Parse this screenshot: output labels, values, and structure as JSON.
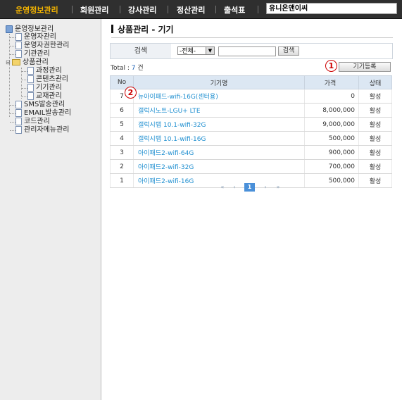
{
  "nav": {
    "items": [
      "운영정보관리",
      "회원관리",
      "강사관리",
      "정산관리",
      "출석표"
    ],
    "active_index": 0,
    "company": "유니온앤이씨"
  },
  "sidebar": {
    "root": "운영정보관리",
    "items": [
      "운영자관리",
      "운영자권한관리",
      "기관관리"
    ],
    "product_folder": "상품관리",
    "product_items": [
      "과정관리",
      "콘텐츠관리",
      "기기관리",
      "교재관리"
    ],
    "bottom_items": [
      "SMS발송관리",
      "EMAIL발송관리",
      "코드관리",
      "관리자메뉴관리"
    ]
  },
  "page": {
    "title": "상품관리 - 기기"
  },
  "search": {
    "label": "검색",
    "select_value": "-전체-",
    "select_arrow": "▼",
    "input_value": "",
    "button": "검색"
  },
  "total": {
    "prefix": "Total : ",
    "count": "7",
    "suffix": " 건"
  },
  "register_button": "기기등록",
  "annotations": {
    "register": "1",
    "row": "2"
  },
  "table": {
    "headers": [
      "No",
      "기기명",
      "가격",
      "상태"
    ],
    "rows": [
      {
        "no": "7",
        "name": "뉴아이패드-wifi-16G(센터용)",
        "price": "0",
        "status": "활성"
      },
      {
        "no": "6",
        "name": "갤럭시노트-LGU+ LTE",
        "price": "8,000,000",
        "status": "활성"
      },
      {
        "no": "5",
        "name": "갤럭시탭 10.1-wifi-32G",
        "price": "9,000,000",
        "status": "활성"
      },
      {
        "no": "4",
        "name": "갤럭시탭 10.1-wifi-16G",
        "price": "500,000",
        "status": "활성"
      },
      {
        "no": "3",
        "name": "아이패드2-wifi-64G",
        "price": "900,000",
        "status": "활성"
      },
      {
        "no": "2",
        "name": "아이패드2-wifi-32G",
        "price": "700,000",
        "status": "활성"
      },
      {
        "no": "1",
        "name": "아이패드2-wifi-16G",
        "price": "500,000",
        "status": "활성"
      }
    ]
  },
  "pagination": {
    "first": "«",
    "prev": "‹",
    "current": "1",
    "next": "›",
    "last": "»"
  },
  "colors": {
    "nav_bg": "#2f2f2f",
    "nav_active": "#f4b400",
    "link": "#1f8fd0",
    "header_bg": "#dce7f3",
    "annotation": "#cc0000"
  }
}
